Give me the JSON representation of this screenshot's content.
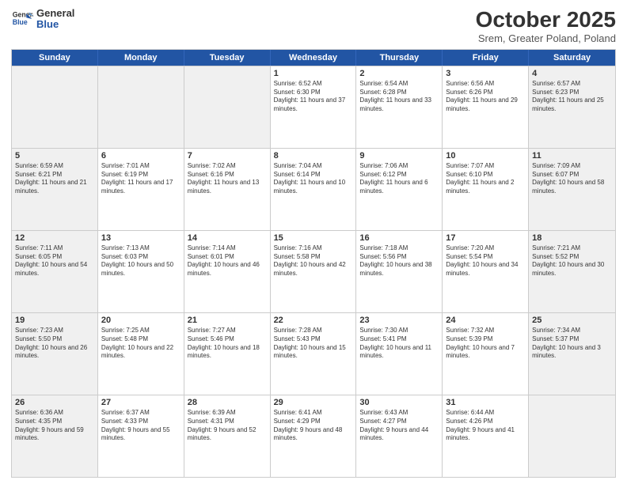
{
  "header": {
    "logo_general": "General",
    "logo_blue": "Blue",
    "title": "October 2025",
    "subtitle": "Srem, Greater Poland, Poland"
  },
  "days_of_week": [
    "Sunday",
    "Monday",
    "Tuesday",
    "Wednesday",
    "Thursday",
    "Friday",
    "Saturday"
  ],
  "weeks": [
    [
      {
        "day": "",
        "text": "",
        "shaded": true
      },
      {
        "day": "",
        "text": "",
        "shaded": true
      },
      {
        "day": "",
        "text": "",
        "shaded": true
      },
      {
        "day": "1",
        "text": "Sunrise: 6:52 AM\nSunset: 6:30 PM\nDaylight: 11 hours and 37 minutes.",
        "shaded": false
      },
      {
        "day": "2",
        "text": "Sunrise: 6:54 AM\nSunset: 6:28 PM\nDaylight: 11 hours and 33 minutes.",
        "shaded": false
      },
      {
        "day": "3",
        "text": "Sunrise: 6:56 AM\nSunset: 6:26 PM\nDaylight: 11 hours and 29 minutes.",
        "shaded": false
      },
      {
        "day": "4",
        "text": "Sunrise: 6:57 AM\nSunset: 6:23 PM\nDaylight: 11 hours and 25 minutes.",
        "shaded": true
      }
    ],
    [
      {
        "day": "5",
        "text": "Sunrise: 6:59 AM\nSunset: 6:21 PM\nDaylight: 11 hours and 21 minutes.",
        "shaded": true
      },
      {
        "day": "6",
        "text": "Sunrise: 7:01 AM\nSunset: 6:19 PM\nDaylight: 11 hours and 17 minutes.",
        "shaded": false
      },
      {
        "day": "7",
        "text": "Sunrise: 7:02 AM\nSunset: 6:16 PM\nDaylight: 11 hours and 13 minutes.",
        "shaded": false
      },
      {
        "day": "8",
        "text": "Sunrise: 7:04 AM\nSunset: 6:14 PM\nDaylight: 11 hours and 10 minutes.",
        "shaded": false
      },
      {
        "day": "9",
        "text": "Sunrise: 7:06 AM\nSunset: 6:12 PM\nDaylight: 11 hours and 6 minutes.",
        "shaded": false
      },
      {
        "day": "10",
        "text": "Sunrise: 7:07 AM\nSunset: 6:10 PM\nDaylight: 11 hours and 2 minutes.",
        "shaded": false
      },
      {
        "day": "11",
        "text": "Sunrise: 7:09 AM\nSunset: 6:07 PM\nDaylight: 10 hours and 58 minutes.",
        "shaded": true
      }
    ],
    [
      {
        "day": "12",
        "text": "Sunrise: 7:11 AM\nSunset: 6:05 PM\nDaylight: 10 hours and 54 minutes.",
        "shaded": true
      },
      {
        "day": "13",
        "text": "Sunrise: 7:13 AM\nSunset: 6:03 PM\nDaylight: 10 hours and 50 minutes.",
        "shaded": false
      },
      {
        "day": "14",
        "text": "Sunrise: 7:14 AM\nSunset: 6:01 PM\nDaylight: 10 hours and 46 minutes.",
        "shaded": false
      },
      {
        "day": "15",
        "text": "Sunrise: 7:16 AM\nSunset: 5:58 PM\nDaylight: 10 hours and 42 minutes.",
        "shaded": false
      },
      {
        "day": "16",
        "text": "Sunrise: 7:18 AM\nSunset: 5:56 PM\nDaylight: 10 hours and 38 minutes.",
        "shaded": false
      },
      {
        "day": "17",
        "text": "Sunrise: 7:20 AM\nSunset: 5:54 PM\nDaylight: 10 hours and 34 minutes.",
        "shaded": false
      },
      {
        "day": "18",
        "text": "Sunrise: 7:21 AM\nSunset: 5:52 PM\nDaylight: 10 hours and 30 minutes.",
        "shaded": true
      }
    ],
    [
      {
        "day": "19",
        "text": "Sunrise: 7:23 AM\nSunset: 5:50 PM\nDaylight: 10 hours and 26 minutes.",
        "shaded": true
      },
      {
        "day": "20",
        "text": "Sunrise: 7:25 AM\nSunset: 5:48 PM\nDaylight: 10 hours and 22 minutes.",
        "shaded": false
      },
      {
        "day": "21",
        "text": "Sunrise: 7:27 AM\nSunset: 5:46 PM\nDaylight: 10 hours and 18 minutes.",
        "shaded": false
      },
      {
        "day": "22",
        "text": "Sunrise: 7:28 AM\nSunset: 5:43 PM\nDaylight: 10 hours and 15 minutes.",
        "shaded": false
      },
      {
        "day": "23",
        "text": "Sunrise: 7:30 AM\nSunset: 5:41 PM\nDaylight: 10 hours and 11 minutes.",
        "shaded": false
      },
      {
        "day": "24",
        "text": "Sunrise: 7:32 AM\nSunset: 5:39 PM\nDaylight: 10 hours and 7 minutes.",
        "shaded": false
      },
      {
        "day": "25",
        "text": "Sunrise: 7:34 AM\nSunset: 5:37 PM\nDaylight: 10 hours and 3 minutes.",
        "shaded": true
      }
    ],
    [
      {
        "day": "26",
        "text": "Sunrise: 6:36 AM\nSunset: 4:35 PM\nDaylight: 9 hours and 59 minutes.",
        "shaded": true
      },
      {
        "day": "27",
        "text": "Sunrise: 6:37 AM\nSunset: 4:33 PM\nDaylight: 9 hours and 55 minutes.",
        "shaded": false
      },
      {
        "day": "28",
        "text": "Sunrise: 6:39 AM\nSunset: 4:31 PM\nDaylight: 9 hours and 52 minutes.",
        "shaded": false
      },
      {
        "day": "29",
        "text": "Sunrise: 6:41 AM\nSunset: 4:29 PM\nDaylight: 9 hours and 48 minutes.",
        "shaded": false
      },
      {
        "day": "30",
        "text": "Sunrise: 6:43 AM\nSunset: 4:27 PM\nDaylight: 9 hours and 44 minutes.",
        "shaded": false
      },
      {
        "day": "31",
        "text": "Sunrise: 6:44 AM\nSunset: 4:26 PM\nDaylight: 9 hours and 41 minutes.",
        "shaded": false
      },
      {
        "day": "",
        "text": "",
        "shaded": true
      }
    ]
  ]
}
